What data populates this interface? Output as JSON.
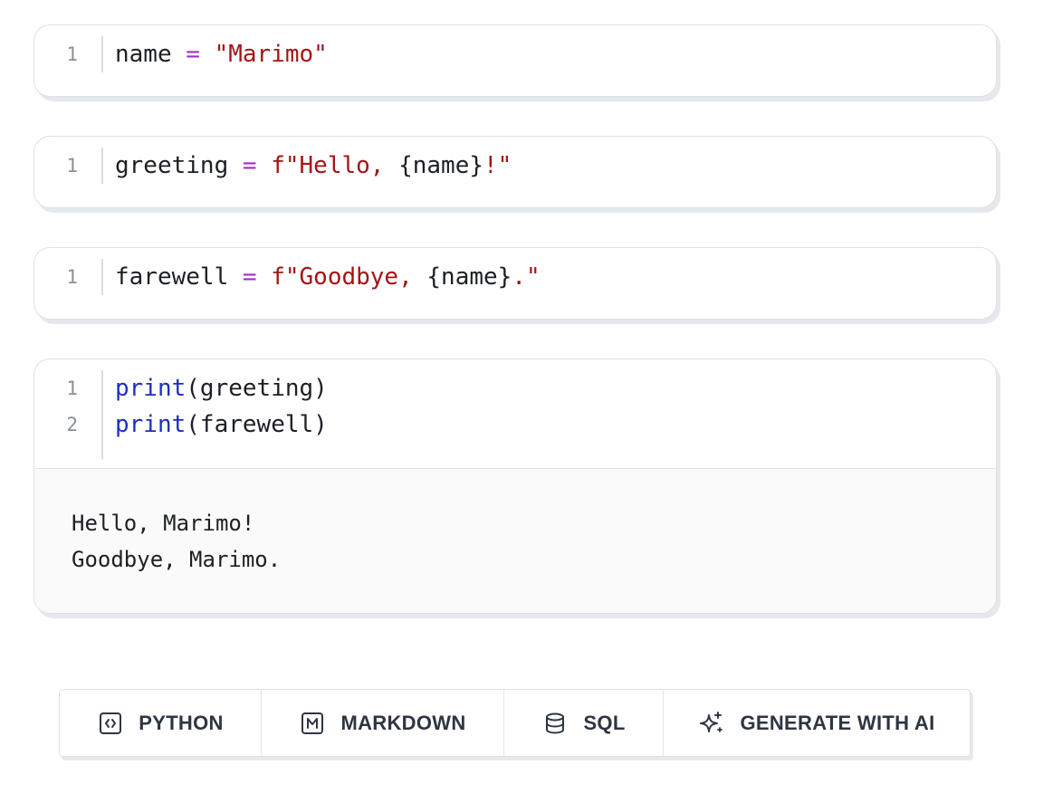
{
  "cells": [
    {
      "line_numbers": [
        "1"
      ],
      "lines": [
        [
          {
            "t": "name",
            "k": "id"
          },
          {
            "t": " ",
            "k": "id"
          },
          {
            "t": "=",
            "k": "op"
          },
          {
            "t": " ",
            "k": "id"
          },
          {
            "t": "\"Marimo\"",
            "k": "str"
          }
        ]
      ]
    },
    {
      "line_numbers": [
        "1"
      ],
      "lines": [
        [
          {
            "t": "greeting",
            "k": "id"
          },
          {
            "t": " ",
            "k": "id"
          },
          {
            "t": "=",
            "k": "op"
          },
          {
            "t": " ",
            "k": "id"
          },
          {
            "t": "f\"Hello, ",
            "k": "str"
          },
          {
            "t": "{name}",
            "k": "id"
          },
          {
            "t": "!\"",
            "k": "str"
          }
        ]
      ]
    },
    {
      "line_numbers": [
        "1"
      ],
      "lines": [
        [
          {
            "t": "farewell",
            "k": "id"
          },
          {
            "t": " ",
            "k": "id"
          },
          {
            "t": "=",
            "k": "op"
          },
          {
            "t": " ",
            "k": "id"
          },
          {
            "t": "f\"Goodbye, ",
            "k": "str"
          },
          {
            "t": "{name}",
            "k": "id"
          },
          {
            "t": ".\"",
            "k": "str"
          }
        ]
      ]
    },
    {
      "line_numbers": [
        "1",
        "2"
      ],
      "lines": [
        [
          {
            "t": "print",
            "k": "fn"
          },
          {
            "t": "(greeting)",
            "k": "id"
          }
        ],
        [
          {
            "t": "print",
            "k": "fn"
          },
          {
            "t": "(farewell)",
            "k": "id"
          }
        ]
      ],
      "output": [
        "Hello, Marimo!",
        "Goodbye, Marimo."
      ]
    }
  ],
  "toolbar": {
    "python_label": "PYTHON",
    "markdown_label": "MARKDOWN",
    "sql_label": "SQL",
    "ai_label": "GENERATE WITH AI"
  },
  "colors": {
    "operator": "#a629c9",
    "string": "#a31515",
    "function": "#1d2fbf",
    "text": "#1c1f24",
    "line_number": "#8a8f98"
  }
}
